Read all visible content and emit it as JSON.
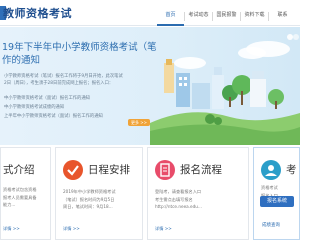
{
  "header": {
    "title": "教师资格考试",
    "nav": [
      "首页",
      "考试动态",
      "国民报警",
      "资料下载",
      "联系"
    ]
  },
  "banner": {
    "title_line1": "19年下半年中小学教师资格考试（笔",
    "title_line2": "作的通知",
    "lines": [
      "小学教师资格考试（笔试）报名工作将于9月日开始，此次笔试",
      "2日（周日），考生须于28日前完成网上报名；报名入口：",
      "中小学教师资格考试（面试）报名工作的通知",
      "中小学教师资格考试成绩的通知",
      "上半年中小学教师资格考试（面试）报名工作的通知"
    ],
    "more": "更多 >>"
  },
  "cards": [
    {
      "title": "式介绍",
      "text": [
        "资格考试包含资格",
        "报考人员需要具备",
        "能力..."
      ],
      "link": "详情 >>"
    },
    {
      "title": "日程安排",
      "text": [
        "2019年中小学教师资格考试",
        "（笔试）报名时间为9月5日",
        "周日，笔试时间：9月18..."
      ],
      "link": "详情 >>"
    },
    {
      "title": "报名流程",
      "text": [
        "登陆考，请查看报名入口",
        "考生需点击填写报名",
        "http://ntce.neea.edu..."
      ],
      "link": "详情 >>"
    },
    {
      "title": "考",
      "text": [
        "资格考试",
        "报名入口"
      ]
    }
  ],
  "register_button": "报名系统",
  "query_button": "成绩查询",
  "colors": {
    "brand": "#2f6fb8",
    "accent": "#f0a338",
    "card1": "#2e86de",
    "card2": "#e8552c",
    "card3": "#e84c6a",
    "card4": "#2b9ec9"
  }
}
